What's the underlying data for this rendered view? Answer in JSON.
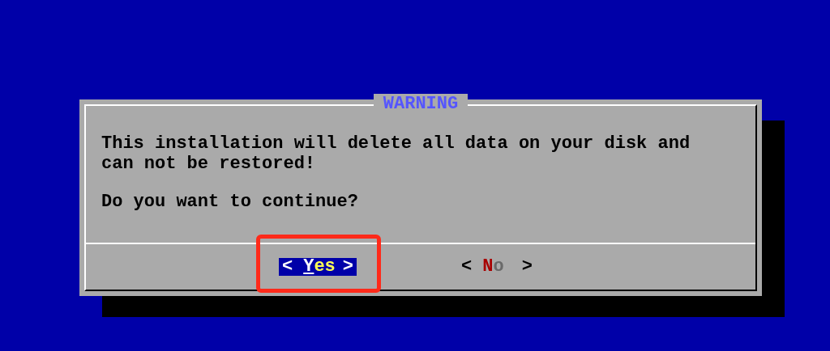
{
  "dialog": {
    "title": "WARNING",
    "message": "This installation will delete all data on your disk and can not be restored!",
    "question": "Do you want to continue?",
    "buttons": [
      {
        "left": "<",
        "label": "Yes",
        "right": ">",
        "selected": true
      },
      {
        "left": "<",
        "label": "No",
        "right": ">",
        "selected": false
      }
    ]
  }
}
